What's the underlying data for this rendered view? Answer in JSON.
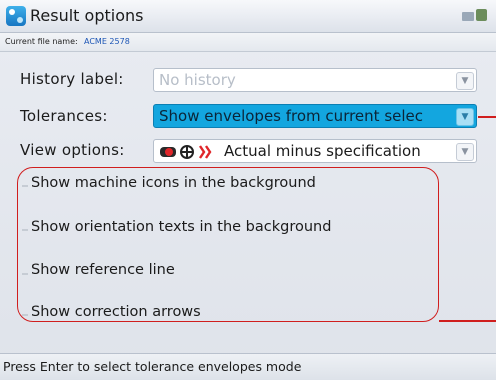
{
  "window": {
    "title": "Result options",
    "app_icon": "app-icon",
    "status_icon": "status-indicator-icon"
  },
  "file_bar": {
    "label": "Current file name:",
    "value": "ACME 2578"
  },
  "fields": {
    "history": {
      "label": "History label:",
      "value": "No history",
      "disabled": true
    },
    "tolerances": {
      "label": "Tolerances:",
      "value": "Show envelopes from current selec",
      "selected": true
    },
    "view": {
      "label": "View options:",
      "value": "Actual minus specification",
      "icons": [
        "red-eye-icon",
        "gear-move-icon",
        "red-symbol-icon"
      ]
    }
  },
  "options": [
    {
      "label": "Show machine icons in the background"
    },
    {
      "label": "Show orientation texts in the background"
    },
    {
      "label": "Show reference line"
    },
    {
      "label": "Show correction arrows"
    }
  ],
  "status_bar": {
    "text": "Press Enter to select tolerance envelopes mode"
  },
  "colors": {
    "highlight": "#13a6df",
    "callout": "#d01e1e",
    "file_name": "#1d56b5"
  }
}
